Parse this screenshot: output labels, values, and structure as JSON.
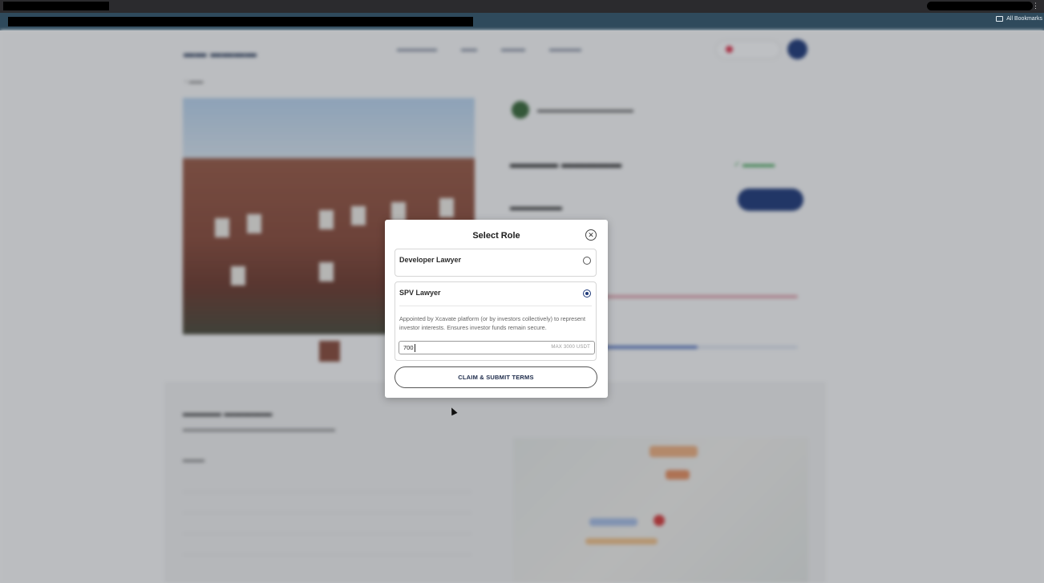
{
  "browser": {
    "bookmarks_label": "All Bookmarks"
  },
  "modal": {
    "title": "Select Role",
    "roles": [
      {
        "name": "Developer Lawyer",
        "selected": false
      },
      {
        "name": "SPV Lawyer",
        "selected": true,
        "description": "Appointed by Xcavate platform (or by investors collectively) to represent investor interests. Ensures investor funds remain secure.",
        "amount_value": "700",
        "max_hint": "MAX 3000 USDT"
      }
    ],
    "submit_label": "CLAIM & SUBMIT TERMS"
  },
  "colors": {
    "accent": "#1f3a7a",
    "overlay": "rgba(40,45,55,0.30)"
  }
}
